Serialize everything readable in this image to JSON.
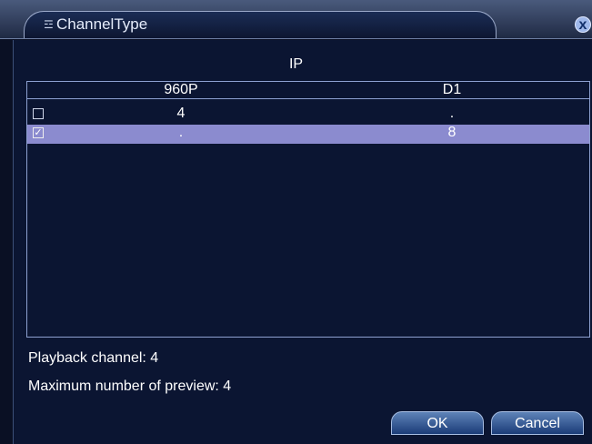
{
  "window": {
    "title": "ChannelType",
    "close_symbol": "x"
  },
  "group_label": "IP",
  "table": {
    "headers": [
      "960P",
      "D1"
    ],
    "rows": [
      {
        "checked": false,
        "check_symbol": "",
        "col_960p": "4",
        "col_d1": "."
      },
      {
        "checked": true,
        "check_symbol": "✓",
        "col_960p": ".",
        "col_d1": "8"
      }
    ]
  },
  "info": {
    "playback": "Playback channel: 4",
    "preview": "Maximum number of preview: 4"
  },
  "buttons": {
    "ok": "OK",
    "cancel": "Cancel"
  },
  "colors": {
    "selected_row": "#8b8bcf",
    "background": "#0b1532"
  }
}
